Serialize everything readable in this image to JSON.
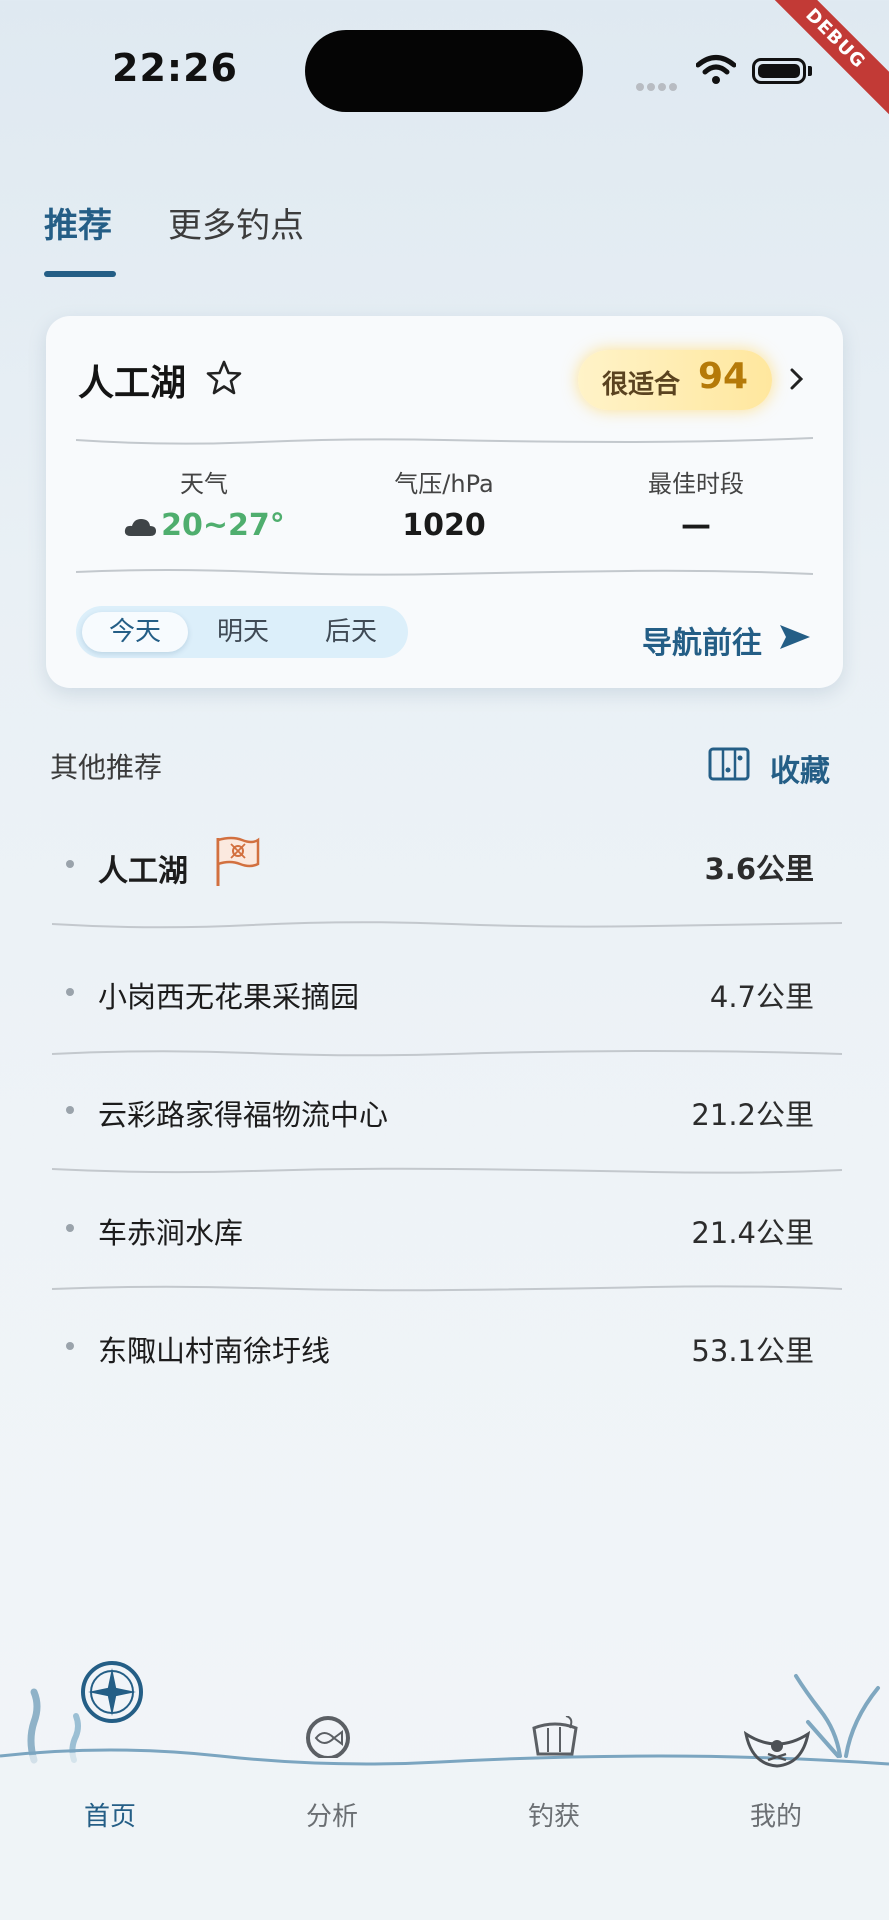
{
  "status_bar": {
    "time": "22:26",
    "debug_banner": "DEBUG"
  },
  "tabs": [
    {
      "label": "推荐",
      "active": true
    },
    {
      "label": "更多钓点",
      "active": false
    }
  ],
  "spot_card": {
    "name": "人工湖",
    "score_label": "很适合",
    "score_value": "94",
    "weather": {
      "label": "天气",
      "value": "20~27°",
      "icon": "cloud-icon"
    },
    "pressure": {
      "label": "气压/hPa",
      "value": "1020"
    },
    "best_time": {
      "label": "最佳时段",
      "value": "—"
    },
    "day_options": [
      "今天",
      "明天",
      "后天"
    ],
    "selected_day": "今天",
    "navigate_label": "导航前往"
  },
  "other": {
    "title": "其他推荐",
    "favorites_label": "收藏",
    "items": [
      {
        "name": "人工湖",
        "distance": "3.6公里",
        "highlight": true,
        "icon": "pirate-flag-icon"
      },
      {
        "name": "小岗西无花果采摘园",
        "distance": "4.7公里",
        "highlight": false
      },
      {
        "name": "云彩路家得福物流中心",
        "distance": "21.2公里",
        "highlight": false
      },
      {
        "name": "车赤涧水库",
        "distance": "21.4公里",
        "highlight": false
      },
      {
        "name": "东陬山村南徐圩线",
        "distance": "53.1公里",
        "highlight": false
      }
    ]
  },
  "bottom_nav": [
    {
      "label": "首页",
      "icon": "compass-icon",
      "active": true
    },
    {
      "label": "分析",
      "icon": "fish-analysis-icon",
      "active": false
    },
    {
      "label": "钓获",
      "icon": "bucket-icon",
      "active": false
    },
    {
      "label": "我的",
      "icon": "pirate-hat-icon",
      "active": false
    }
  ],
  "colors": {
    "accent": "#245e86",
    "weather_green": "#4fae6e",
    "score_gold": "#b57a08",
    "flag_orange": "#d2703f"
  }
}
